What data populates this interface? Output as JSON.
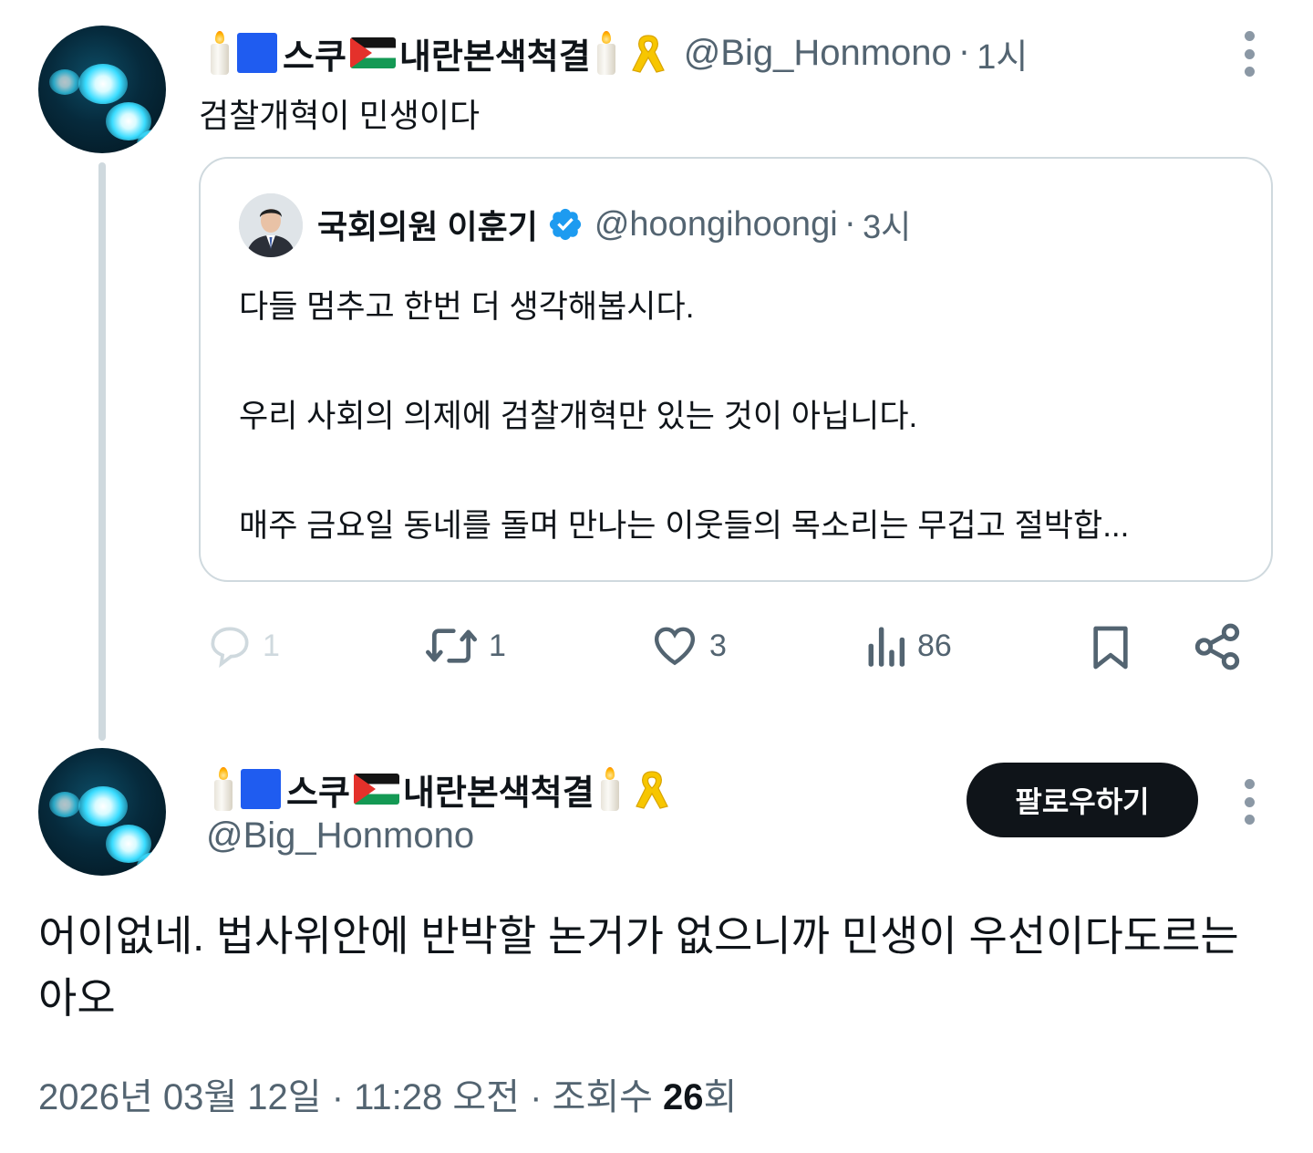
{
  "parent_tweet": {
    "display_name": "스쿠내란본색척결",
    "handle": "@Big_Honmono",
    "time": "1시",
    "text": "검찰개혁이 민생이다",
    "actions": {
      "reply_count": "1",
      "repost_count": "1",
      "like_count": "3",
      "view_count": "86"
    }
  },
  "quoted_tweet": {
    "display_name": "국회의원 이훈기",
    "handle": "@hoongihoongi",
    "time": "3시",
    "lines": [
      "다들 멈추고 한번 더 생각해봅시다.",
      "우리 사회의 의제에 검찰개혁만 있는 것이 아닙니다.",
      "매주 금요일 동네를 돌며 만나는 이웃들의 목소리는 무겁고 절박합..."
    ]
  },
  "main_tweet": {
    "display_name": "스쿠내란본색척결",
    "handle": "@Big_Honmono",
    "follow_label": "팔로우하기",
    "text": "어이없네. 법사위안에 반박할 논거가 없으니까 민생이 우선이다도르는 아오",
    "meta_prefix": "2026년 03월 12일 · 11:28 오전 · 조회수 ",
    "views": "26",
    "views_suffix": "회"
  },
  "colors": {
    "text_primary": "#0f1419",
    "text_secondary": "#536471",
    "border": "#cfd9de",
    "verified_blue": "#1d9bf0",
    "follow_button_bg": "#0f1419"
  },
  "icons": [
    "candle-icon",
    "blue-square-icon",
    "palestine-flag-icon",
    "yellow-ribbon-icon",
    "more-icon",
    "verified-badge-icon",
    "reply-icon",
    "repost-icon",
    "like-icon",
    "views-icon",
    "bookmark-icon",
    "share-icon"
  ]
}
